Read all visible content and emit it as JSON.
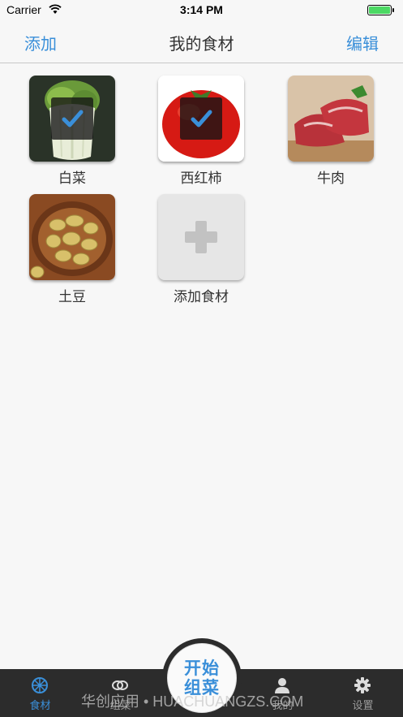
{
  "status_bar": {
    "carrier": "Carrier",
    "time": "3:14 PM"
  },
  "nav": {
    "left_button": "添加",
    "title": "我的食材",
    "right_button": "编辑"
  },
  "ingredients": [
    {
      "label": "白菜",
      "selected": true,
      "image": "napa-cabbage"
    },
    {
      "label": "西红柿",
      "selected": true,
      "image": "tomato"
    },
    {
      "label": "牛肉",
      "selected": false,
      "image": "beef"
    },
    {
      "label": "土豆",
      "selected": false,
      "image": "potatoes"
    }
  ],
  "add_tile": {
    "label": "添加食材"
  },
  "tabs": [
    {
      "label": "食材",
      "icon": "ingredients-icon",
      "active": true
    },
    {
      "label": "组菜",
      "icon": "combo-icon",
      "active": false
    },
    {
      "label": "我的",
      "icon": "person-icon",
      "active": false
    },
    {
      "label": "设置",
      "icon": "gear-icon",
      "active": false
    }
  ],
  "center_button": {
    "line1": "开始",
    "line2": "组菜"
  },
  "watermark": "华创应用 • HUACHUANGZS.COM",
  "colors": {
    "accent": "#3a8fd9",
    "tab_bar": "#2c2c2c",
    "background": "#f7f7f7"
  }
}
